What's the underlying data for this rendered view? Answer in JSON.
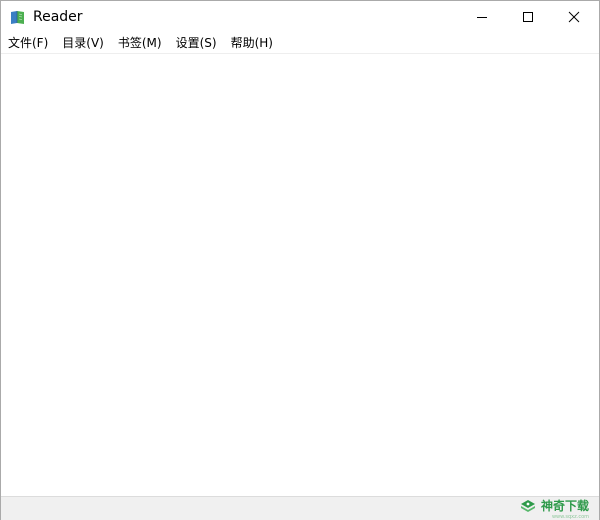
{
  "window": {
    "title": "Reader",
    "app_icon": "book-icon"
  },
  "caption_buttons": {
    "minimize_icon": "minimize-icon",
    "maximize_icon": "maximize-icon",
    "close_icon": "close-icon"
  },
  "menu": {
    "items": [
      {
        "label": "文件(F)"
      },
      {
        "label": "目录(V)"
      },
      {
        "label": "书签(M)"
      },
      {
        "label": "设置(S)"
      },
      {
        "label": "帮助(H)"
      }
    ]
  },
  "watermark": {
    "text": "神奇下载",
    "sub": "www.sqxz.com",
    "icon": "watermark-logo-icon",
    "color": "#2e9a4a"
  }
}
